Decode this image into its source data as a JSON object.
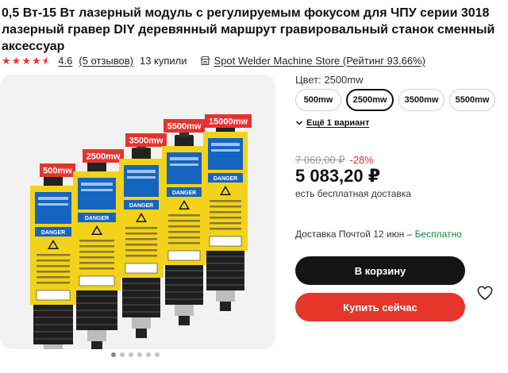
{
  "product": {
    "title": "0,5 Вт-15 Вт лазерный модуль с регулируемым фокусом для ЧПУ серии 3018 лазерный гравер DIY деревянный маршрут гравировальный станок сменный аксессуар"
  },
  "rating": {
    "value": "4.6",
    "stars": 4.6,
    "reviews": "(5 отзывов)",
    "bought": "13 купили"
  },
  "store": {
    "name": "Spot Welder Machine Store (Рейтинг 93.66%)"
  },
  "gallery": {
    "modules": [
      {
        "label": "500mw"
      },
      {
        "label": "2500mw"
      },
      {
        "label": "3500mw"
      },
      {
        "label": "5500mw"
      },
      {
        "label": "15000mw"
      }
    ],
    "warning_text": "DANGER",
    "slide_count": 6,
    "active_slide": 1
  },
  "options": {
    "color_label": "Цвет: 2500mw",
    "variants": [
      {
        "label": "500mw",
        "selected": false
      },
      {
        "label": "2500mw",
        "selected": true
      },
      {
        "label": "3500mw",
        "selected": false
      },
      {
        "label": "5500mw",
        "selected": false
      }
    ],
    "more_label": "Ещё 1 вариант"
  },
  "pricing": {
    "old_price": "7 060,00 ₽",
    "discount": "-28%",
    "price": "5 083,20 ₽",
    "shipping": "есть бесплатная доставка"
  },
  "delivery": {
    "text": "Доставка Почтой 12 июн – ",
    "free": "Бесплатно"
  },
  "actions": {
    "cart": "В корзину",
    "buy": "Купить сейчас"
  },
  "colors": {
    "accent": "#e4362a",
    "dark_button": "#141414",
    "label_red": "#e3342f",
    "module_yellow": "#f2d21b",
    "module_blue": "#1565c0"
  }
}
